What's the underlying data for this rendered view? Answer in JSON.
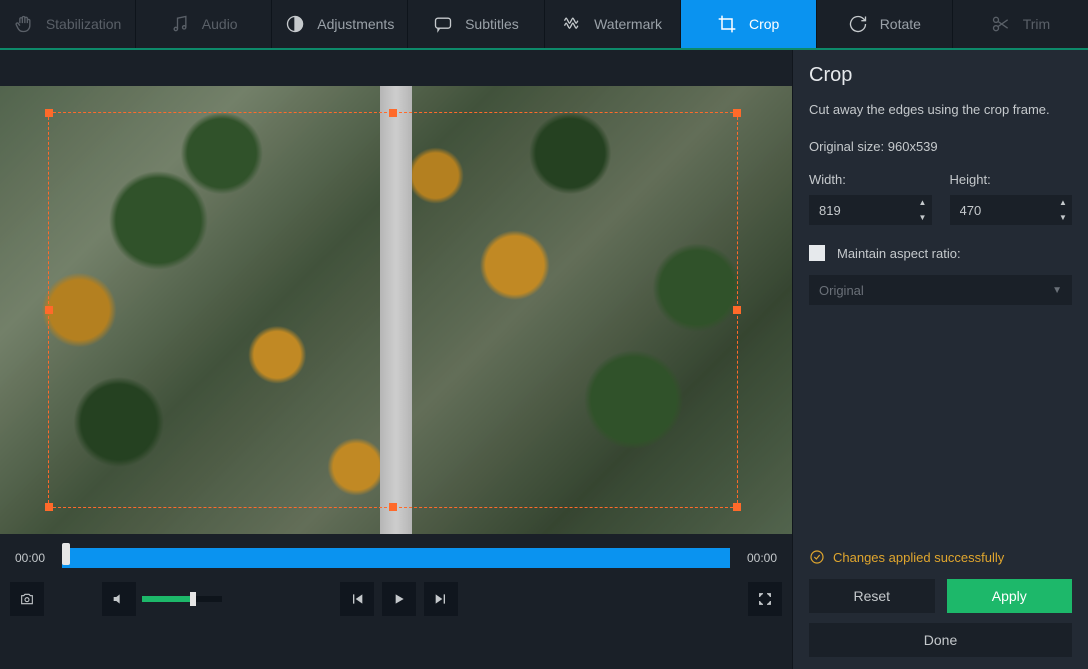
{
  "tabs": {
    "stabilization": "Stabilization",
    "audio": "Audio",
    "adjustments": "Adjustments",
    "subtitles": "Subtitles",
    "watermark": "Watermark",
    "crop": "Crop",
    "rotate": "Rotate",
    "trim": "Trim"
  },
  "timeline": {
    "start": "00:00",
    "end": "00:00"
  },
  "panel": {
    "title": "Crop",
    "desc": "Cut away the edges using the crop frame.",
    "original_label": "Original size: 960x539",
    "width_label": "Width:",
    "height_label": "Height:",
    "width_value": "819",
    "height_value": "470",
    "maintain_label": "Maintain aspect ratio:",
    "ratio_value": "Original",
    "status_text": "Changes applied successfully",
    "reset": "Reset",
    "apply": "Apply",
    "done": "Done"
  }
}
